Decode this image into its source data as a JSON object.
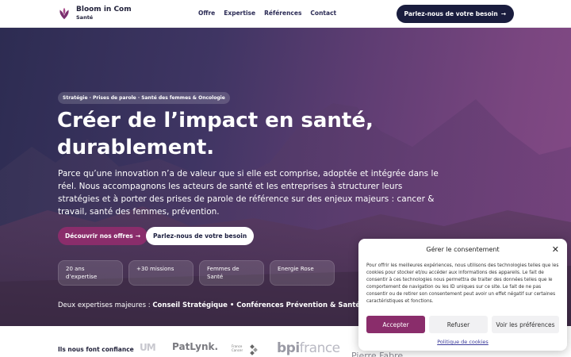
{
  "header": {
    "brand_name": "Bloom in Com",
    "brand_sub": "Santé",
    "nav": [
      {
        "label": "Offre"
      },
      {
        "label": "Expertise"
      },
      {
        "label": "Références"
      },
      {
        "label": "Contact"
      }
    ],
    "cta_label": "Parlez-nous de votre besoin",
    "cta_arrow": "→"
  },
  "hero": {
    "pill": "Stratégie · Prises de parole · Santé des femmes & Oncologie",
    "title": "Créer de l’impact en santé, durablement.",
    "lead": "Parce qu’une innovation n’a de valeur que si elle est comprise, adoptée et intégrée dans le réel. Nous accompagnons les acteurs de santé et les entreprises à structurer leurs stratégies et à porter des prises de parole de référence sur des enjeux majeurs : cancer & travail, santé des femmes, prévention.",
    "btn_primary": "Découvrir nos offres",
    "btn_primary_arrow": "→",
    "btn_secondary": "Parlez-nous de votre besoin",
    "stats": [
      {
        "label": "20 ans d’expertise"
      },
      {
        "label": "+30 missions"
      },
      {
        "label": "Femmes de Santé"
      },
      {
        "label": "Energie Rose"
      }
    ],
    "expertise_prefix": "Deux expertises majeures :",
    "expertise_bold": "Conseil Stratégique • Conférences Prévention & Santé"
  },
  "logos": {
    "label": "Ils nous font confiance",
    "items": [
      {
        "text": "UM"
      },
      {
        "text": "PatLynk."
      },
      {
        "text": "France Cancer"
      },
      {
        "text": "bpi",
        "text2": "france"
      },
      {
        "text": "Pierre Fabre"
      }
    ]
  },
  "consent": {
    "title": "Gérer le consentement",
    "close": "✕",
    "body": "Pour offrir les meilleures expériences, nous utilisons des technologies telles que les cookies pour stocker et/ou accéder aux informations des appareils. Le fait de consentir à ces technologies nous permettra de traiter des données telles que le comportement de navigation ou les ID uniques sur ce site. Le fait de ne pas consentir ou de retirer son consentement peut avoir un effet négatif sur certaines caractéristiques et fonctions.",
    "accept": "Accepter",
    "refuse": "Refuser",
    "prefs": "Voir les préférences",
    "policy_link": "Politique de cookies"
  },
  "colors": {
    "brand_dark": "#1a1d3e",
    "brand_accent": "#8a2d6b"
  }
}
